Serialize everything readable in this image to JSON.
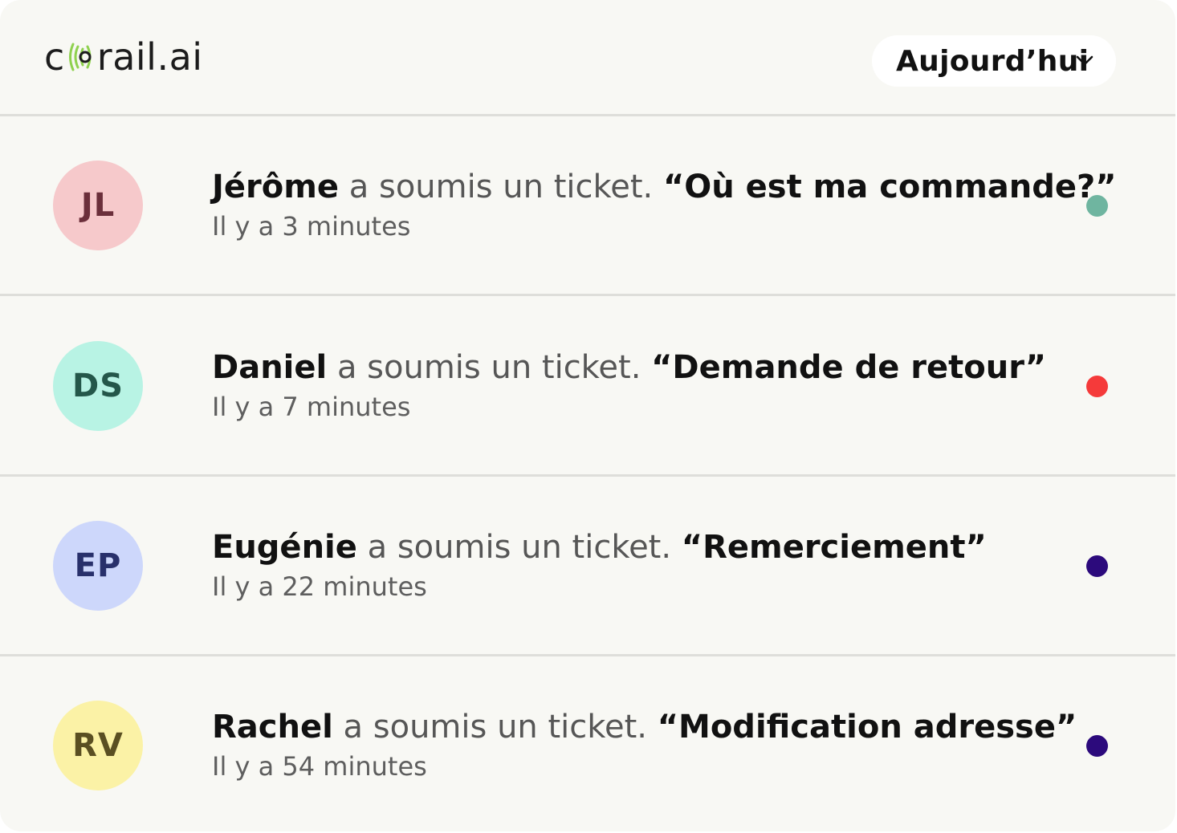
{
  "brand": {
    "logo_prefix": "c",
    "logo_suffix": "rail.ai",
    "logo_icon": "coral-wave-icon",
    "logo_icon_color": "#8fd14f"
  },
  "filter": {
    "label": "Aujourd’hui",
    "icon": "chevron-down-icon"
  },
  "tickets": [
    {
      "initials": "JL",
      "avatar_bg": "#f6c9cb",
      "avatar_fg": "#6b2f3b",
      "name": "Jérôme",
      "action": " a soumis un ticket. ",
      "subject": "“Où est ma commande?”",
      "time": "Il y a 3 minutes",
      "status_color": "#6fb5a0"
    },
    {
      "initials": "DS",
      "avatar_bg": "#b8f3e4",
      "avatar_fg": "#24574a",
      "name": "Daniel",
      "action": " a soumis un ticket. ",
      "subject": "“Demande de retour”",
      "time": "Il y a 7 minutes",
      "status_color": "#f53a3a"
    },
    {
      "initials": "EP",
      "avatar_bg": "#cdd7fb",
      "avatar_fg": "#28306b",
      "name": "Eugénie",
      "action": " a soumis un ticket. ",
      "subject": "“Remerciement”",
      "time": "Il y a 22 minutes",
      "status_color": "#2c0a7c"
    },
    {
      "initials": "RV",
      "avatar_bg": "#fbf2a6",
      "avatar_fg": "#5a4f22",
      "name": "Rachel",
      "action": " a soumis un ticket. ",
      "subject": "“Modification adresse”",
      "time": "Il y a 54 minutes",
      "status_color": "#2c0a7c"
    }
  ]
}
